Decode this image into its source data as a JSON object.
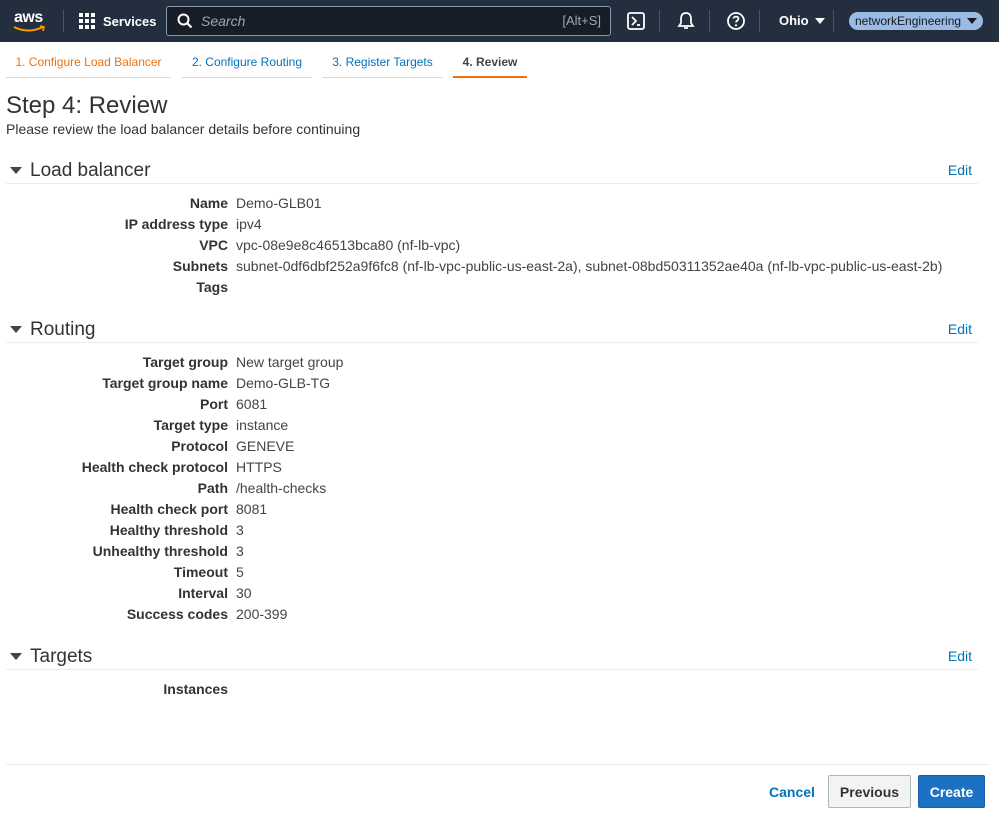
{
  "nav": {
    "logo_text": "aws",
    "services_label": "Services",
    "search_placeholder": "Search",
    "search_shortcut": "[Alt+S]",
    "region": "Ohio",
    "account": "networkEngineering"
  },
  "tabs": [
    {
      "label": "1. Configure Load Balancer",
      "state": "done"
    },
    {
      "label": "2. Configure Routing",
      "state": "link"
    },
    {
      "label": "3. Register Targets",
      "state": "link"
    },
    {
      "label": "4. Review",
      "state": "active"
    }
  ],
  "page": {
    "title": "Step 4: Review",
    "subtitle": "Please review the load balancer details before continuing"
  },
  "edit_label": "Edit",
  "sections": {
    "load_balancer": {
      "title": "Load balancer",
      "rows": [
        {
          "key": "Name",
          "value": "Demo-GLB01"
        },
        {
          "key": "IP address type",
          "value": "ipv4"
        },
        {
          "key": "VPC",
          "value": "vpc-08e9e8c46513bca80 (nf-lb-vpc)"
        },
        {
          "key": "Subnets",
          "value": "subnet-0df6dbf252a9f6fc8 (nf-lb-vpc-public-us-east-2a), subnet-08bd50311352ae40a (nf-lb-vpc-public-us-east-2b)"
        },
        {
          "key": "Tags",
          "value": ""
        }
      ]
    },
    "routing": {
      "title": "Routing",
      "rows": [
        {
          "key": "Target group",
          "value": "New target group"
        },
        {
          "key": "Target group name",
          "value": "Demo-GLB-TG"
        },
        {
          "key": "Port",
          "value": "6081"
        },
        {
          "key": "Target type",
          "value": "instance"
        },
        {
          "key": "Protocol",
          "value": "GENEVE"
        },
        {
          "key": "Health check protocol",
          "value": "HTTPS"
        },
        {
          "key": "Path",
          "value": "/health-checks"
        },
        {
          "key": "Health check port",
          "value": "8081"
        },
        {
          "key": "Healthy threshold",
          "value": "3"
        },
        {
          "key": "Unhealthy threshold",
          "value": "3"
        },
        {
          "key": "Timeout",
          "value": "5"
        },
        {
          "key": "Interval",
          "value": "30"
        },
        {
          "key": "Success codes",
          "value": "200-399"
        }
      ]
    },
    "targets": {
      "title": "Targets",
      "rows": [
        {
          "key": "Instances",
          "value": ""
        }
      ]
    }
  },
  "footer": {
    "cancel": "Cancel",
    "previous": "Previous",
    "create": "Create"
  }
}
